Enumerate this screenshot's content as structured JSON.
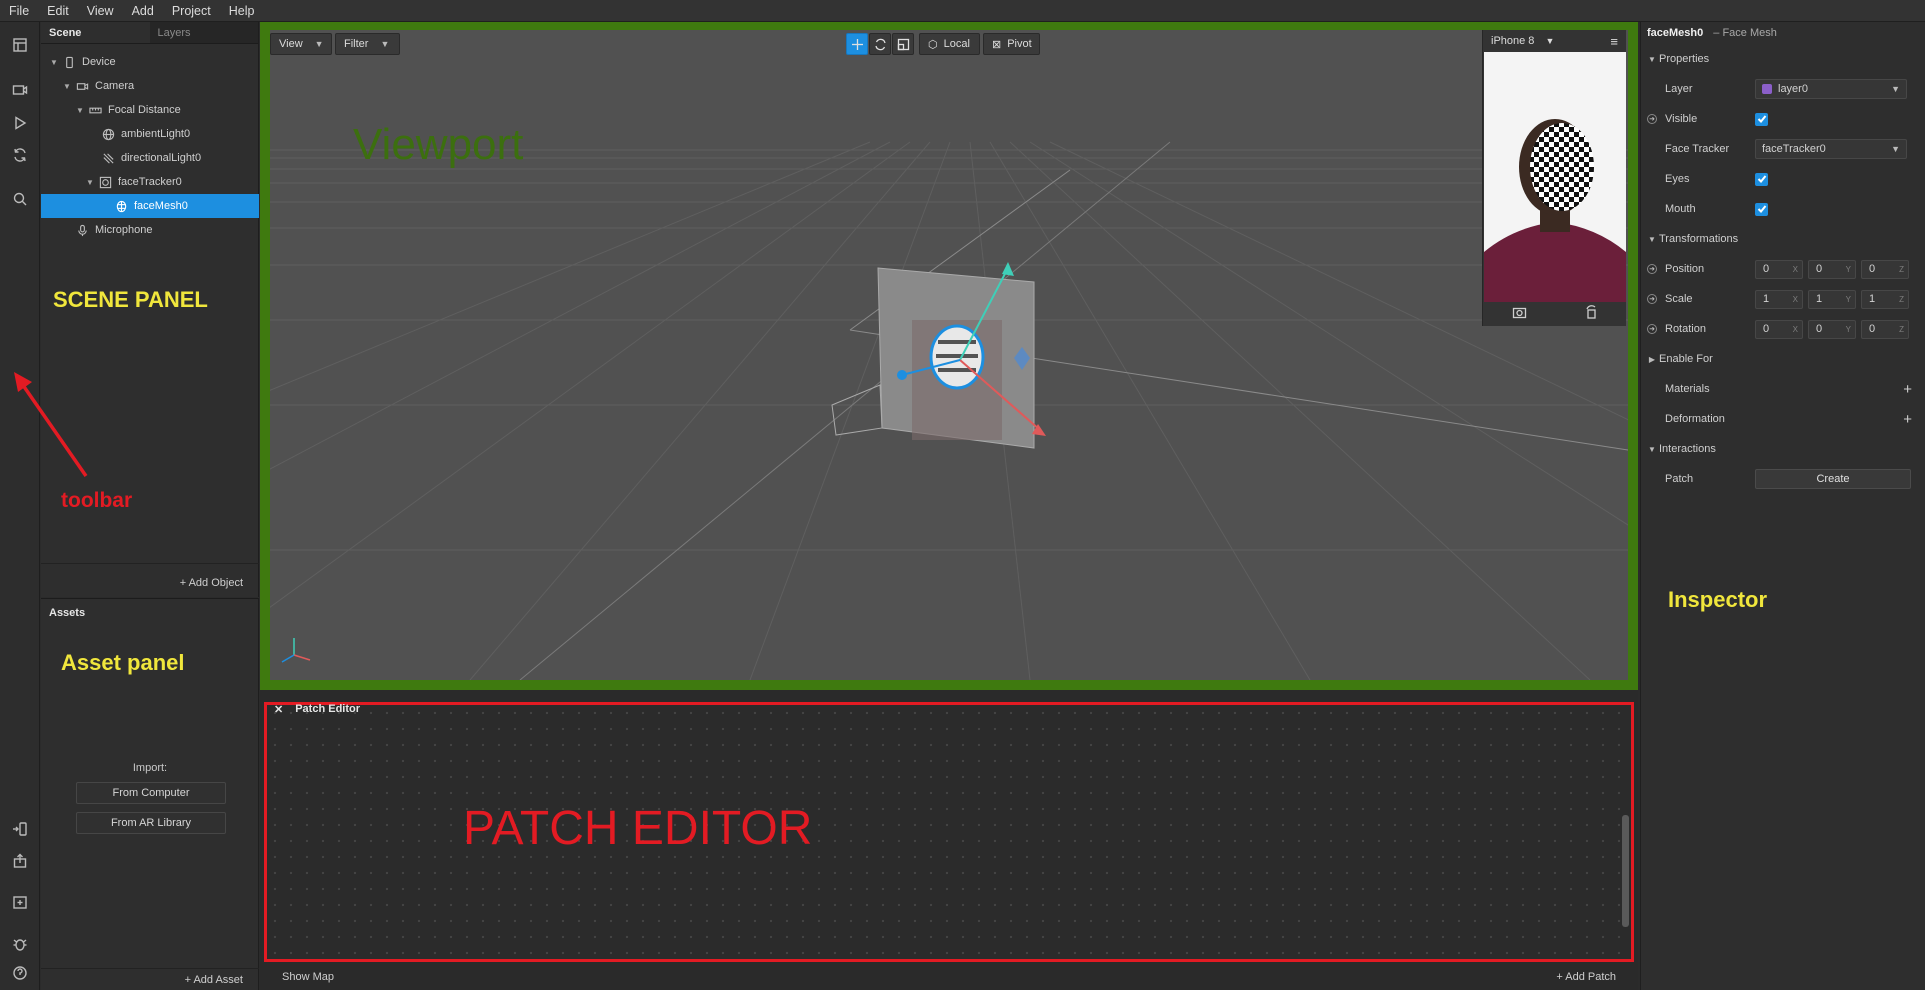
{
  "menu": [
    "File",
    "Edit",
    "View",
    "Add",
    "Project",
    "Help"
  ],
  "scene_panel": {
    "tabs": [
      "Scene",
      "Layers"
    ],
    "tree": [
      {
        "label": "Device",
        "depth": 0,
        "expanded": true,
        "icon": "device-icon"
      },
      {
        "label": "Camera",
        "depth": 1,
        "expanded": true,
        "icon": "camera-icon"
      },
      {
        "label": "Focal Distance",
        "depth": 2,
        "expanded": true,
        "icon": "ruler-icon"
      },
      {
        "label": "ambientLight0",
        "depth": 3,
        "icon": "globe-icon"
      },
      {
        "label": "directionalLight0",
        "depth": 3,
        "icon": "directional-light-icon"
      },
      {
        "label": "faceTracker0",
        "depth": 3,
        "expanded": true,
        "icon": "face-tracker-icon"
      },
      {
        "label": "faceMesh0",
        "depth": 4,
        "selected": true,
        "icon": "face-mesh-icon"
      },
      {
        "label": "Microphone",
        "depth": 1,
        "icon": "microphone-icon"
      }
    ],
    "add_object": "Add Object"
  },
  "assets_panel": {
    "title": "Assets",
    "import_label": "Import:",
    "from_computer": "From Computer",
    "from_library": "From AR Library",
    "add_asset": "Add Asset"
  },
  "viewport": {
    "view_label": "View",
    "filter_label": "Filter",
    "local_label": "Local",
    "pivot_label": "Pivot",
    "device": "iPhone 8"
  },
  "patch_editor": {
    "title": "Patch Editor",
    "show_map": "Show Map",
    "add_patch": "Add Patch"
  },
  "inspector": {
    "object_name": "faceMesh0",
    "object_type": "– Face Mesh",
    "properties": "Properties",
    "layer_label": "Layer",
    "layer_value": "layer0",
    "visible_label": "Visible",
    "face_tracker_label": "Face Tracker",
    "face_tracker_value": "faceTracker0",
    "eyes_label": "Eyes",
    "mouth_label": "Mouth",
    "transformations": "Transformations",
    "position_label": "Position",
    "position": [
      "0",
      "0",
      "0"
    ],
    "scale_label": "Scale",
    "scale": [
      "1",
      "1",
      "1"
    ],
    "rotation_label": "Rotation",
    "rotation": [
      "0",
      "0",
      "0"
    ],
    "axes": [
      "X",
      "Y",
      "Z"
    ],
    "enable_for": "Enable For",
    "materials": "Materials",
    "deformation": "Deformation",
    "interactions": "Interactions",
    "patch_label": "Patch",
    "create_label": "Create"
  },
  "annotations": {
    "viewport": "Viewport",
    "scene_panel": "SCENE PANEL",
    "toolbar": "toolbar",
    "asset_panel": "Asset panel",
    "patch_editor": "PATCH EDITOR",
    "inspector": "Inspector"
  },
  "colors": {
    "accent": "#1d8fe0",
    "viewport_border": "#3f7a0f",
    "patch_border": "#e31b23",
    "annotation_yellow": "#f0e63c"
  }
}
